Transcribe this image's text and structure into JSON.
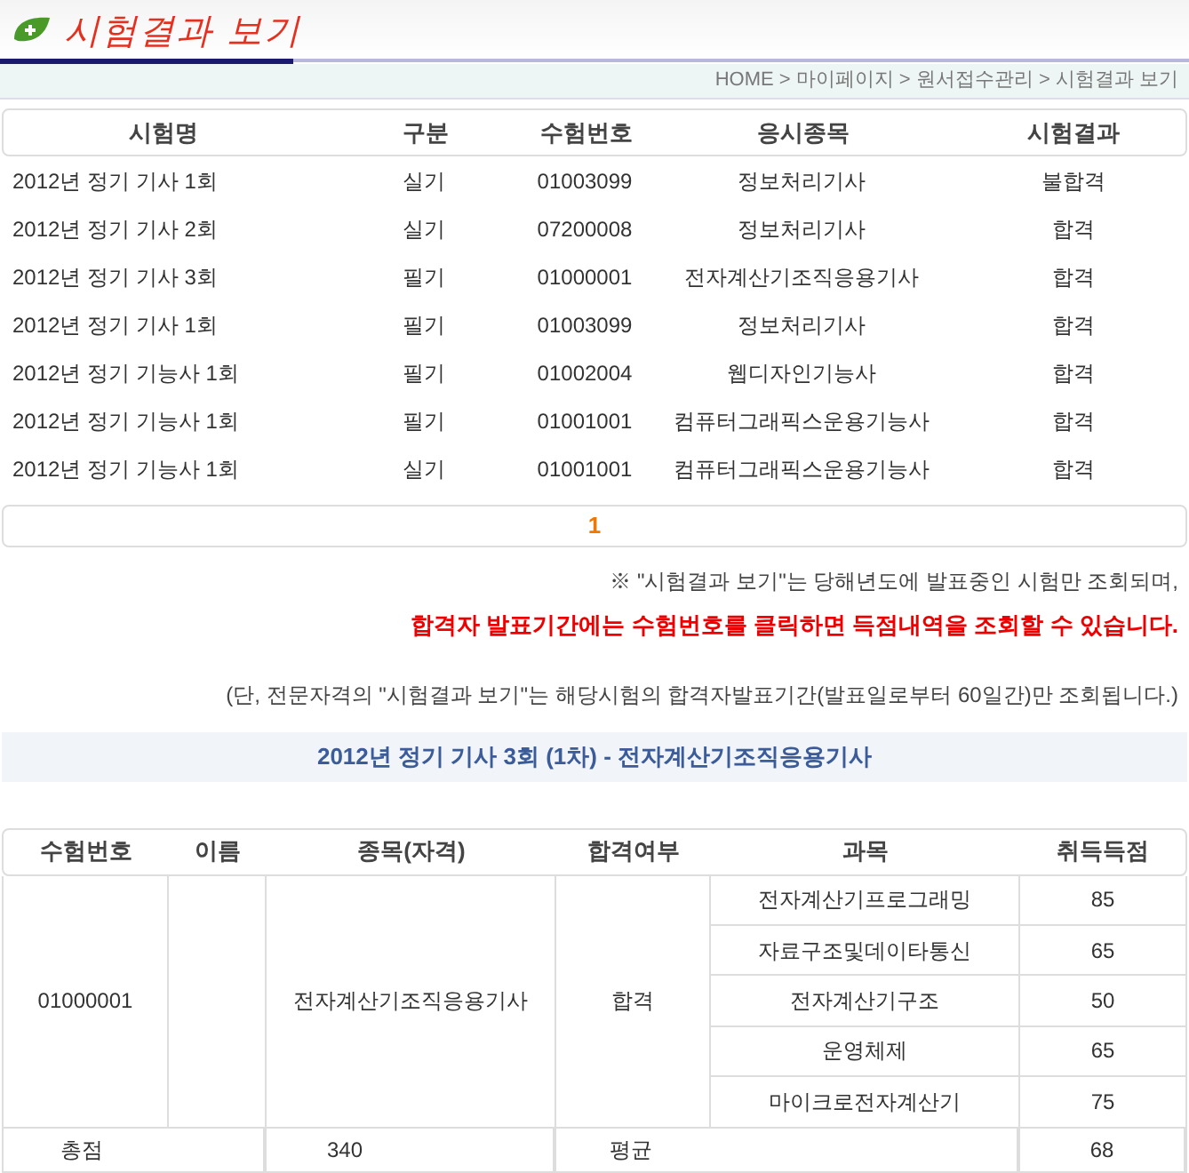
{
  "title": "시험결과 보기",
  "breadcrumb": "HOME > 마이페이지 > 원서접수관리 > 시험결과 보기",
  "results_table": {
    "columns": [
      "시험명",
      "구분",
      "수험번호",
      "응시종목",
      "시험결과"
    ],
    "rows": [
      [
        "2012년 정기 기사 1회",
        "실기",
        "01003099",
        "정보처리기사",
        "불합격"
      ],
      [
        "2012년 정기 기사 2회",
        "실기",
        "07200008",
        "정보처리기사",
        "합격"
      ],
      [
        "2012년 정기 기사 3회",
        "필기",
        "01000001",
        "전자계산기조직응용기사",
        "합격"
      ],
      [
        "2012년 정기 기사 1회",
        "필기",
        "01003099",
        "정보처리기사",
        "합격"
      ],
      [
        "2012년 정기 기능사 1회",
        "필기",
        "01002004",
        "웹디자인기능사",
        "합격"
      ],
      [
        "2012년 정기 기능사 1회",
        "필기",
        "01001001",
        "컴퓨터그래픽스운용기능사",
        "합격"
      ],
      [
        "2012년 정기 기능사 1회",
        "실기",
        "01001001",
        "컴퓨터그래픽스운용기능사",
        "합격"
      ]
    ]
  },
  "pagination": [
    {
      "label": "1",
      "selected": true
    }
  ],
  "notes": [
    {
      "kind": "normal",
      "text": "※ \"시험결과 보기\"는 당해년도에 발표중인 시험만 조회되며,"
    },
    {
      "kind": "emphasis",
      "text": "합격자 발표기간에는 수험번호를 클릭하면 득점내역을 조회할 수 있습니다."
    },
    {
      "kind": "gap",
      "text": "(단, 전문자격의 \"시험결과 보기\"는 해당시험의 합격자발표기간(발표일로부터 60일간)만 조회됩니다.)"
    }
  ],
  "detail": {
    "title": "2012년 정기 기사 3회 (1차) - 전자계산기조직응용기사",
    "columns": [
      "수험번호",
      "이름",
      "종목(자격)",
      "합격여부",
      "과목",
      "취득득점"
    ],
    "candidate_number": "01000001",
    "certification": "전자계산기조직응용기사",
    "pass_status": "합격",
    "subjects": [
      {
        "name": "전자계산기프로그래밍",
        "score": "85"
      },
      {
        "name": "자료구조및데이타통신",
        "score": "65"
      },
      {
        "name": "전자계산기구조",
        "score": "50"
      },
      {
        "name": "운영체제",
        "score": "65"
      },
      {
        "name": "마이크로전자계산기",
        "score": "75"
      }
    ],
    "total_label": "총점",
    "total": "340",
    "average_label": "평균",
    "average": "68"
  }
}
